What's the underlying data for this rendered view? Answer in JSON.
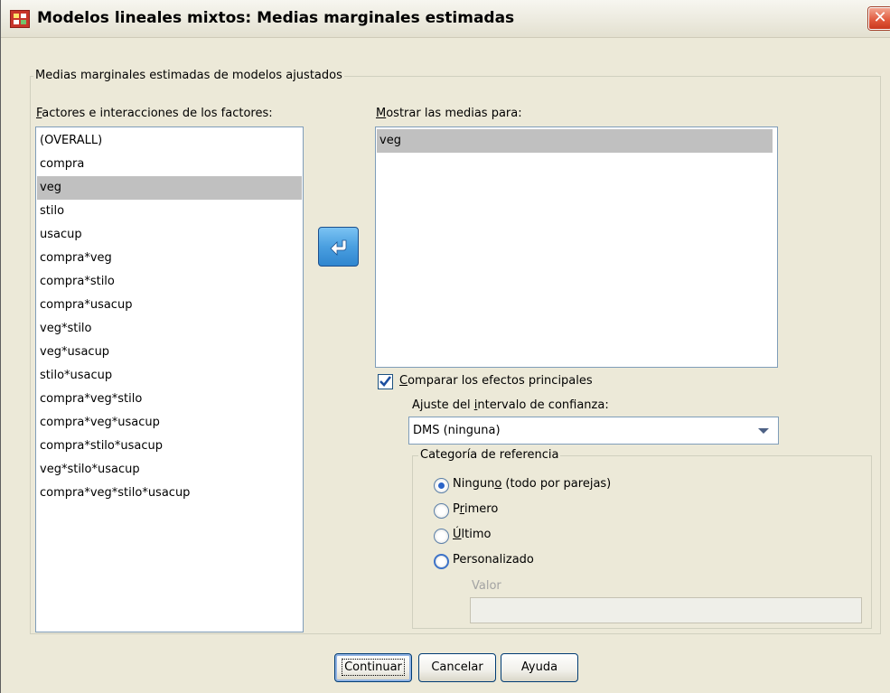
{
  "window": {
    "title": "Modelos lineales mixtos: Medias marginales estimadas",
    "close_glyph": "✕"
  },
  "group_main": {
    "legend": "Medias marginales estimadas de modelos ajustados"
  },
  "factors": {
    "label": "Factores e interacciones de los factores:",
    "items": [
      "(OVERALL)",
      "compra",
      "veg",
      "stilo",
      "usacup",
      "compra*veg",
      "compra*stilo",
      "compra*usacup",
      "veg*stilo",
      "veg*usacup",
      "stilo*usacup",
      "compra*veg*stilo",
      "compra*veg*usacup",
      "compra*stilo*usacup",
      "veg*stilo*usacup",
      "compra*veg*stilo*usacup"
    ],
    "selected": "veg"
  },
  "move_button": {
    "icon": "arrow-left-icon"
  },
  "display_means": {
    "label": "Mostrar las medias para:",
    "items": [
      "veg"
    ]
  },
  "compare": {
    "label": "Comparar los efectos principales",
    "checked": true
  },
  "adjust": {
    "label": "Ajuste del intervalo de confianza:",
    "value": "DMS (ninguna)"
  },
  "reference": {
    "legend": "Categoría de referencia",
    "options": [
      "Ninguno (todo por parejas)",
      "Primero",
      "Último",
      "Personalizado"
    ],
    "selected": "Ninguno (todo por parejas)",
    "value_label": "Valor",
    "value": ""
  },
  "buttons": {
    "continue": "Continuar",
    "cancel": "Cancelar",
    "help": "Ayuda"
  },
  "colors": {
    "dialog_bg": "#ece9d8",
    "selection": "#c0c0c0",
    "accent": "#2a63c7"
  }
}
